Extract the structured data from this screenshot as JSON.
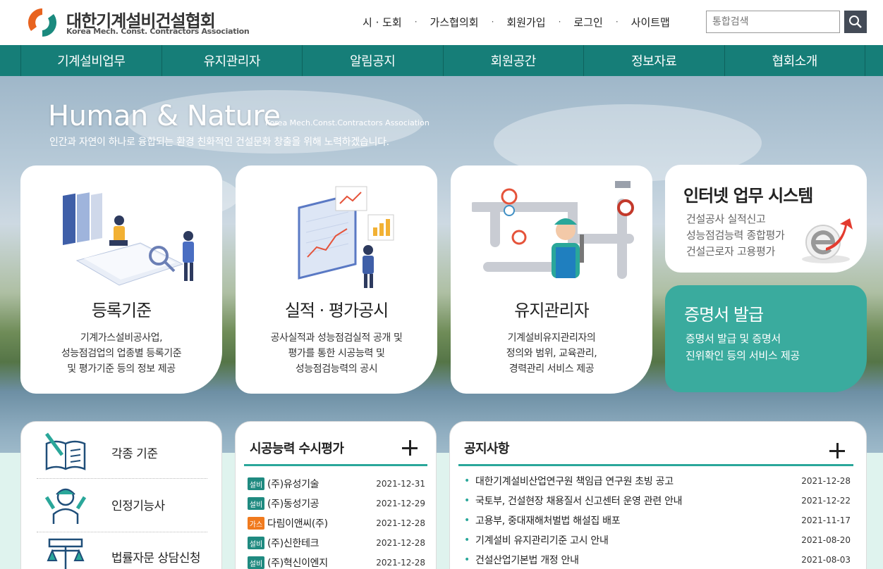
{
  "header": {
    "logo_ko": "대한기계설비건설협회",
    "logo_en": "Korea Mech. Const. Contractors Association",
    "util_links": [
      "시 · 도회",
      "가스협의회",
      "회원가입",
      "로그인",
      "사이트맵"
    ],
    "search_placeholder": "통합검색"
  },
  "nav": [
    "기계설비업무",
    "유지관리자",
    "알림공지",
    "회원공간",
    "정보자료",
    "협회소개"
  ],
  "hero": {
    "title": "Human & Nature",
    "title_en": "Korea Mech.Const.Contractors Association",
    "subtitle": "인간과 자연이 하나로 융합되는 환경 친화적인 건설문화 창출을 위해 노력하겠습니다."
  },
  "cards": [
    {
      "title": "등록기준",
      "desc": [
        "기계가스설비공사업,",
        "성능점검업의 업종별 등록기준",
        "및 평가기준 등의 정보 제공"
      ]
    },
    {
      "title": "실적 · 평가공시",
      "desc": [
        "공사실적과 성능점검실적 공개 및",
        "평가를 통한 시공능력 및",
        "성능점검능력의 공시"
      ]
    },
    {
      "title": "유지관리자",
      "desc": [
        "기계설비유지관리자의",
        "정의와 범위, 교육관리,",
        "경력관리 서비스 제공"
      ]
    }
  ],
  "internet_system": {
    "title": "인터넷 업무 시스템",
    "items": [
      "건설공사 실적신고",
      "성능점검능력 종합평가",
      "건설근로자 고용평가"
    ]
  },
  "certificate": {
    "title": "증명서 발급",
    "desc": [
      "증명서 발급 및 증명서",
      "진위확인 등의 서비스 제공"
    ]
  },
  "quick_links": [
    "각종 기준",
    "인정기능사",
    "법률자문 상담신청"
  ],
  "evaluation": {
    "title": "시공능력 수시평가",
    "items": [
      {
        "badge": "설비",
        "color": "#1f8a80",
        "name": "(주)유성기술",
        "date": "2021-12-31"
      },
      {
        "badge": "설비",
        "color": "#1f8a80",
        "name": "(주)동성기공",
        "date": "2021-12-29"
      },
      {
        "badge": "가스",
        "color": "#f07a1e",
        "name": "다림이앤씨(주)",
        "date": "2021-12-28"
      },
      {
        "badge": "설비",
        "color": "#1f8a80",
        "name": "(주)신한테크",
        "date": "2021-12-28"
      },
      {
        "badge": "설비",
        "color": "#1f8a80",
        "name": "(주)혁신이엔지",
        "date": "2021-12-28"
      }
    ]
  },
  "notice": {
    "title": "공지사항",
    "items": [
      {
        "name": "대한기계설비산업연구원 책임급 연구원 초빙 공고",
        "date": "2021-12-28"
      },
      {
        "name": "국토부, 건설현장 채용질서 신고센터 운영 관련 안내",
        "date": "2021-12-22"
      },
      {
        "name": "고용부, 중대재해처벌법 해설집 배포",
        "date": "2021-11-17"
      },
      {
        "name": "기계설비 유지관리기준 고시 안내",
        "date": "2021-08-20"
      },
      {
        "name": "건설산업기본법 개정 안내",
        "date": "2021-08-03"
      }
    ]
  },
  "colors": {
    "brand_teal": "#167e78",
    "accent_teal": "#3aab9e",
    "gas_orange": "#f07a1e"
  }
}
